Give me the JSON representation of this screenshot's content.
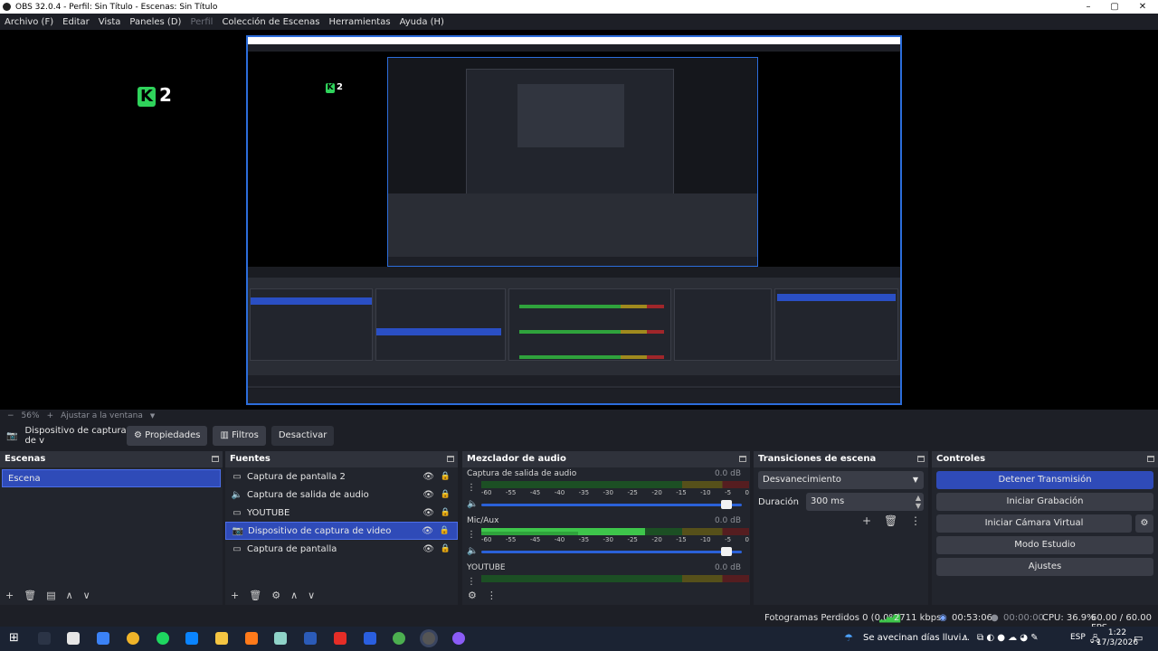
{
  "window": {
    "title": "OBS 32.0.4 - Perfil: Sin Título - Escenas: Sin Título",
    "controls": {
      "minimize": "–",
      "maximize": "▢",
      "close": "✕"
    }
  },
  "menu": {
    "items": [
      "Archivo (F)",
      "Editar",
      "Vista",
      "Paneles (D)",
      "Perfil",
      "Colección de Escenas",
      "Herramientas",
      "Ayuda (H)"
    ]
  },
  "preview": {
    "logo_text": "2",
    "logo_letter": "K"
  },
  "zoom": {
    "minus": "−",
    "level": "56%",
    "plus": "+",
    "fit": "Ajustar a la ventana",
    "fit_arrow": "▼"
  },
  "source_toolbar": {
    "source_name": "Dispositivo de captura de v",
    "properties": "Propiedades",
    "filters": "Filtros",
    "deactivate": "Desactivar"
  },
  "scenes": {
    "title": "Escenas",
    "items": [
      {
        "label": "Escena"
      }
    ],
    "footer": [
      "+",
      "🗑",
      "▤",
      "∧",
      "∨"
    ]
  },
  "sources": {
    "title": "Fuentes",
    "items": [
      {
        "label": "Captura de pantalla 2",
        "icon": "monitor-icon",
        "glyph": "▭"
      },
      {
        "label": "Captura de salida de audio",
        "icon": "speaker-icon",
        "glyph": "🔈"
      },
      {
        "label": "YOUTUBE",
        "icon": "browser-icon",
        "glyph": "▭"
      },
      {
        "label": "Dispositivo de captura de video",
        "icon": "camera-icon",
        "glyph": "📷"
      },
      {
        "label": "Captura de pantalla",
        "icon": "monitor-icon",
        "glyph": "▭"
      }
    ],
    "footer": [
      "+",
      "🗑",
      "⚙",
      "∧",
      "∨"
    ]
  },
  "mixer": {
    "title": "Mezclador de audio",
    "scale": [
      "-60",
      "-55",
      "-45",
      "-40",
      "-35",
      "-30",
      "-25",
      "-20",
      "-15",
      "-10",
      "-5",
      "0"
    ],
    "channels": [
      {
        "name": "Captura de salida de audio",
        "db": "0.0 dB",
        "level": 0.0
      },
      {
        "name": "Mic/Aux",
        "db": "0.0 dB",
        "level": 0.61
      },
      {
        "name": "YOUTUBE",
        "db": "0.0 dB",
        "level": 0.0
      }
    ],
    "footer": [
      "⚙",
      "⋮"
    ]
  },
  "transitions": {
    "title": "Transiciones de escena",
    "selected": "Desvanecimiento",
    "duration_label": "Duración",
    "duration_value": "300 ms",
    "tools": [
      "+",
      "🗑",
      "⋮"
    ]
  },
  "controls": {
    "title": "Controles",
    "stop_stream": "Detener Transmisión",
    "start_record": "Iniciar Grabación",
    "start_vcam": "Iniciar Cámara Virtual",
    "studio_mode": "Modo Estudio",
    "settings": "Ajustes"
  },
  "status": {
    "dropped": "Fotogramas Perdidos 0 (0.0%)",
    "bitrate": "2711 kbps",
    "stream_time": "00:53:06",
    "rec_time": "00:00:00",
    "cpu": "CPU: 36.9%",
    "fps": "60.00 / 60.00 FPS"
  },
  "taskbar": {
    "weather": "Se avecinan días lluvi...",
    "lang": "ESP",
    "time": "1:22",
    "date": "17/3/2026"
  },
  "colors": {
    "accent": "#2f4bb8",
    "panel": "#22252d",
    "meter_green": "#3ec64b"
  }
}
